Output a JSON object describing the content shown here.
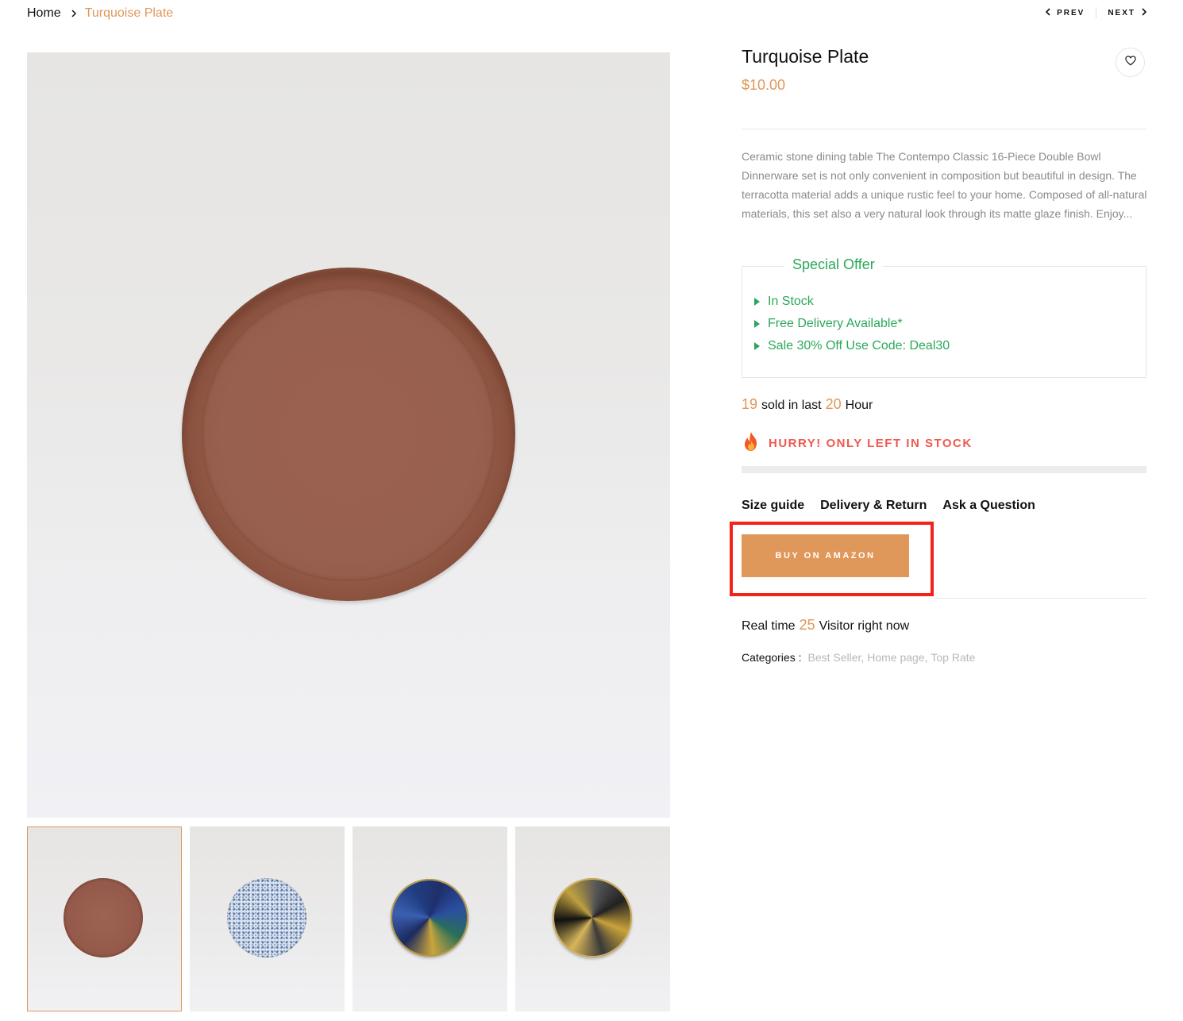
{
  "breadcrumb": {
    "home": "Home",
    "current": "Turquoise Plate"
  },
  "pager": {
    "prev": "PREV",
    "next": "NEXT"
  },
  "gallery": {
    "main_alt": "Terracotta plate",
    "thumbnails": [
      "Terracotta plate",
      "Blue pattern plate",
      "Blue abstract plate",
      "Black gold plate"
    ]
  },
  "product": {
    "title": "Turquoise Plate",
    "price": "$10.00",
    "description": "Ceramic stone dining table The Contempo Classic 16-Piece Double Bowl Dinnerware set is not only convenient in composition but beautiful in design. The terracotta material adds a unique rustic feel to your home. Composed of all-natural materials, this set also a very natural look through its matte glaze finish. Enjoy..."
  },
  "offer": {
    "title": "Special Offer",
    "items": [
      "In Stock",
      "Free Delivery Available*",
      "Sale 30% Off Use Code: Deal30"
    ]
  },
  "sold": {
    "count": "19",
    "middle": "sold in last",
    "hours": "20",
    "suffix": "Hour"
  },
  "stock": {
    "hurry": "HURRY! ONLY LEFT IN STOCK",
    "level": 0
  },
  "links": {
    "size_guide": "Size guide",
    "delivery": "Delivery & Return",
    "ask": "Ask a Question"
  },
  "buy": {
    "label": "BUY ON AMAZON"
  },
  "visitors": {
    "prefix": "Real time",
    "count": "25",
    "suffix": "Visitor right now"
  },
  "categories": {
    "label": "Categories :",
    "items": [
      "Best Seller,",
      "Home page,",
      "Top Rate"
    ]
  },
  "colors": {
    "accent": "#e0975a",
    "offer_green": "#2aa85a",
    "hurry_red": "#f0584f",
    "highlight_red": "#f2241a"
  }
}
